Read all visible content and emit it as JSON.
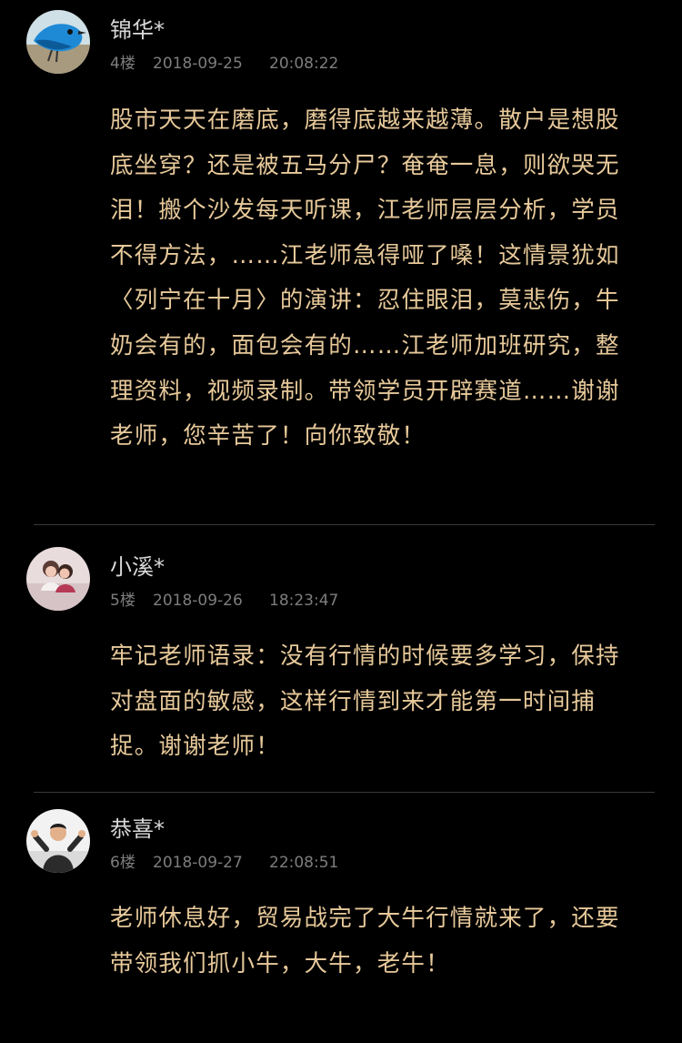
{
  "comments": [
    {
      "author": "锦华*",
      "floor": "4楼",
      "date": "2018-09-25",
      "time": "20:08:22",
      "avatar_icon": "blue-bird-avatar-icon",
      "text": "股市天天在磨底，磨得底越来越薄。散户是想股底坐穿？还是被五马分尸？奄奄一息，则欲哭无泪！搬个沙发每天听课，江老师层层分析，学员不得方法，……江老师急得哑了嗓！这情景犹如〈列宁在十月〉的演讲：忍住眼泪，莫悲伤，牛奶会有的，面包会有的……江老师加班研究，整理资料，视频录制。带领学员开辟赛道……谢谢老师，您辛苦了！向你致敬！"
    },
    {
      "author": "小溪*",
      "floor": "5楼",
      "date": "2018-09-26",
      "time": "18:23:47",
      "avatar_icon": "couple-photo-avatar-icon",
      "text": "牢记老师语录：没有行情的时候要多学习，保持对盘面的敏感，这样行情到来才能第一时间捕捉。谢谢老师！"
    },
    {
      "author": "恭喜*",
      "floor": "6楼",
      "date": "2018-09-27",
      "time": "22:08:51",
      "avatar_icon": "man-waving-avatar-icon",
      "text": "老师休息好，贸易战完了大牛行情就来了，还要带领我们抓小牛，大牛，老牛！"
    }
  ],
  "colors": {
    "background": "#000000",
    "author": "#d9d9d9",
    "meta": "#7d7d7d",
    "comment_text": "#e7c99a",
    "divider": "#3a3a3a"
  }
}
